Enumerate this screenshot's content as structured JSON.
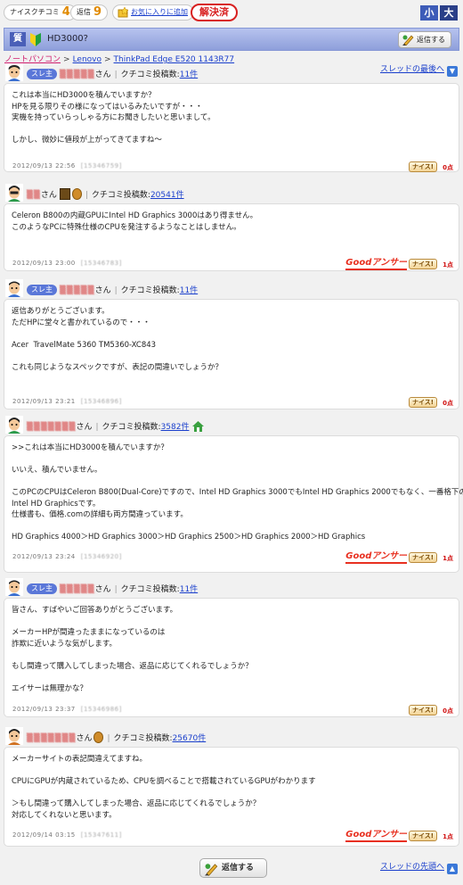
{
  "topbar": {
    "nice_label": "ナイスクチコミ",
    "nice_count": "4",
    "reply_label": "返信",
    "reply_count": "9",
    "favorite_label": "お気に入りに追加",
    "solved_label": "解決済",
    "font_small": "小",
    "font_large": "大"
  },
  "question": {
    "tag": "質",
    "title": "HD3000?",
    "reply_button": "返信する"
  },
  "breadcrumb": {
    "items": [
      "ノートパソコン",
      "Lenovo",
      "ThinkPad Edge E520 1143R77"
    ],
    "sep": ">"
  },
  "nav": {
    "to_end": "スレッドの最後へ",
    "to_start": "スレッドの先頭へ",
    "bottom_reply": "返信する"
  },
  "labels": {
    "post_count_label": "クチコミ投稿数:",
    "thread_owner": "スレ主",
    "san": "さん",
    "nice_button": "ナイス!",
    "good_answer": "Goodアンサー"
  },
  "posts": [
    {
      "user": "▒▒▒▒▒",
      "count": "11件",
      "text": "これは本当にHD3000を積んでいますか？\nHPを見る限りその様になってはいるみたいですが・・・\n実機を持っていらっしゃる方にお聞きしたいと思いまして。\n\nしかし、微妙に値段が上がってきてますね～",
      "date": "2012/09/13 22:56",
      "id": "[15346759]",
      "points": "0点"
    },
    {
      "user": "▒▒",
      "count": "20541件",
      "text": "Celeron B800の内蔵GPUにIntel HD Graphics 3000はあり得ません。\nこのようなPCに特殊仕様のCPUを発注するようなことはしません。",
      "date": "2012/09/13 23:00",
      "id": "[15346783]",
      "points": "1点"
    },
    {
      "user": "▒▒▒▒▒",
      "count": "11件",
      "text": "返信ありがとうございます。\nただHPに堂々と書かれているので・・・\n\nAcer  TravelMate 5360 TM5360-XC843\n\nこれも同じようなスペックですが、表記の間違いでしょうか？",
      "date": "2012/09/13 23:21",
      "id": "[15346896]",
      "points": "0点"
    },
    {
      "user": "▒▒▒▒▒▒▒",
      "count": "3582件",
      "text": ">>これは本当にHD3000を積んでいますか？\n\nいいえ、積んでいません。\n\nこのPCのCPUはCeleron B800(Dual-Core)ですので、Intel HD Graphics 3000でもIntel HD Graphics 2000でもなく、一番格下の\nIntel HD Graphicsです。\n仕様書も、価格.comの詳細も両方間違っています。\n\nHD Graphics 4000＞HD Graphics 3000＞HD Graphics 2500＞HD Graphics 2000＞HD Graphics",
      "date": "2012/09/13 23:24",
      "id": "[15346920]",
      "points": "1点"
    },
    {
      "user": "▒▒▒▒▒",
      "count": "11件",
      "text": "皆さん、すばやいご回答ありがとうございます。\n\nメーカーHPが間違ったままになっているのは\n詐欺に近いような気がします。\n\nもし間違って購入してしまった場合、返品に応じてくれるでしょうか？\n\nエイサーは無理かな？",
      "date": "2012/09/13 23:37",
      "id": "[15346986]",
      "points": "0点"
    },
    {
      "user": "▒▒▒▒▒▒▒",
      "count": "25670件",
      "text": "メーカーサイトの表記間違えてますね。\n\nCPUにGPUが内蔵されているため、CPUを調べることで搭載されているGPUがわかります\n\n＞もし間違って購入してしまった場合、返品に応じてくれるでしょうか？\n対応してくれないと思います。",
      "date": "2012/09/14 03:15",
      "id": "[15347611]",
      "points": "1点"
    }
  ]
}
